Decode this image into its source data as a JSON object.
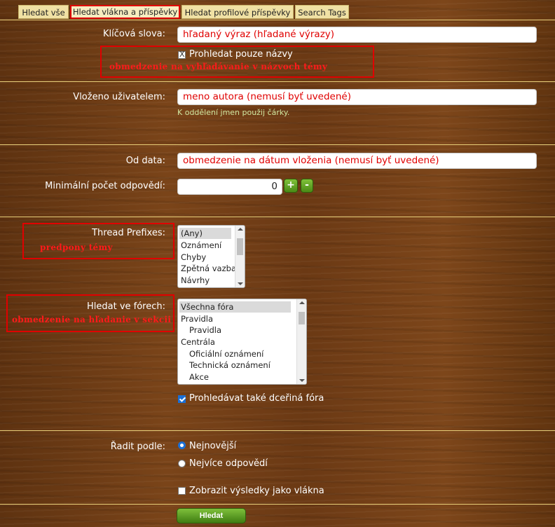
{
  "tabs": [
    "Hledat vše",
    "Hledat vlákna a příspěvky",
    "Hledat profilové příspěvky",
    "Search Tags"
  ],
  "keywords": {
    "label": "Klíčová slova:",
    "value": "hľadaný výraz (hľadané výrazy)",
    "titles_only_label": "Prohledat pouze názvy",
    "annotation": "obmedzenie na vyhľadávanie v názvoch témy"
  },
  "posted_by": {
    "label": "Vloženo uživatelem:",
    "value": "meno autora (nemusí byť uvedené)",
    "hint": "K oddělení jmen použij čárky."
  },
  "date": {
    "label": "Od data:",
    "value": "obmedzenie na dátum vloženia (nemusí byť uvedené)"
  },
  "min_replies": {
    "label": "Minimální počet odpovědí:",
    "value": "0",
    "plus": "+",
    "minus": "-"
  },
  "prefixes": {
    "label": "Thread Prefixes:",
    "annotation": "predpony témy",
    "options": [
      "(Any)",
      "Oznámení",
      "Chyby",
      "Zpětná vazba",
      "Návrhy"
    ]
  },
  "forums": {
    "label": "Hledat ve fórech:",
    "annotation": "obmedzenie na hľadanie v sekcii",
    "options": [
      "Všechna fóra",
      "Pravidla",
      "Pravidla",
      "Centrála",
      "Oficiální oznámení",
      "Technická oznámení",
      "Akce"
    ],
    "child_label": "Prohledávat také dceřiná fóra"
  },
  "order": {
    "label": "Řadit podle:",
    "option_newest": "Nejnovější",
    "option_replies": "Nejvíce odpovědí"
  },
  "group_label": "Zobrazit výsledky jako vlákna",
  "submit": "Hledat",
  "colors": {
    "annotation": "#e00000",
    "button_green": "#5a9e22",
    "hint_green": "#cfe6a0",
    "separator": "#e8cf7a"
  }
}
